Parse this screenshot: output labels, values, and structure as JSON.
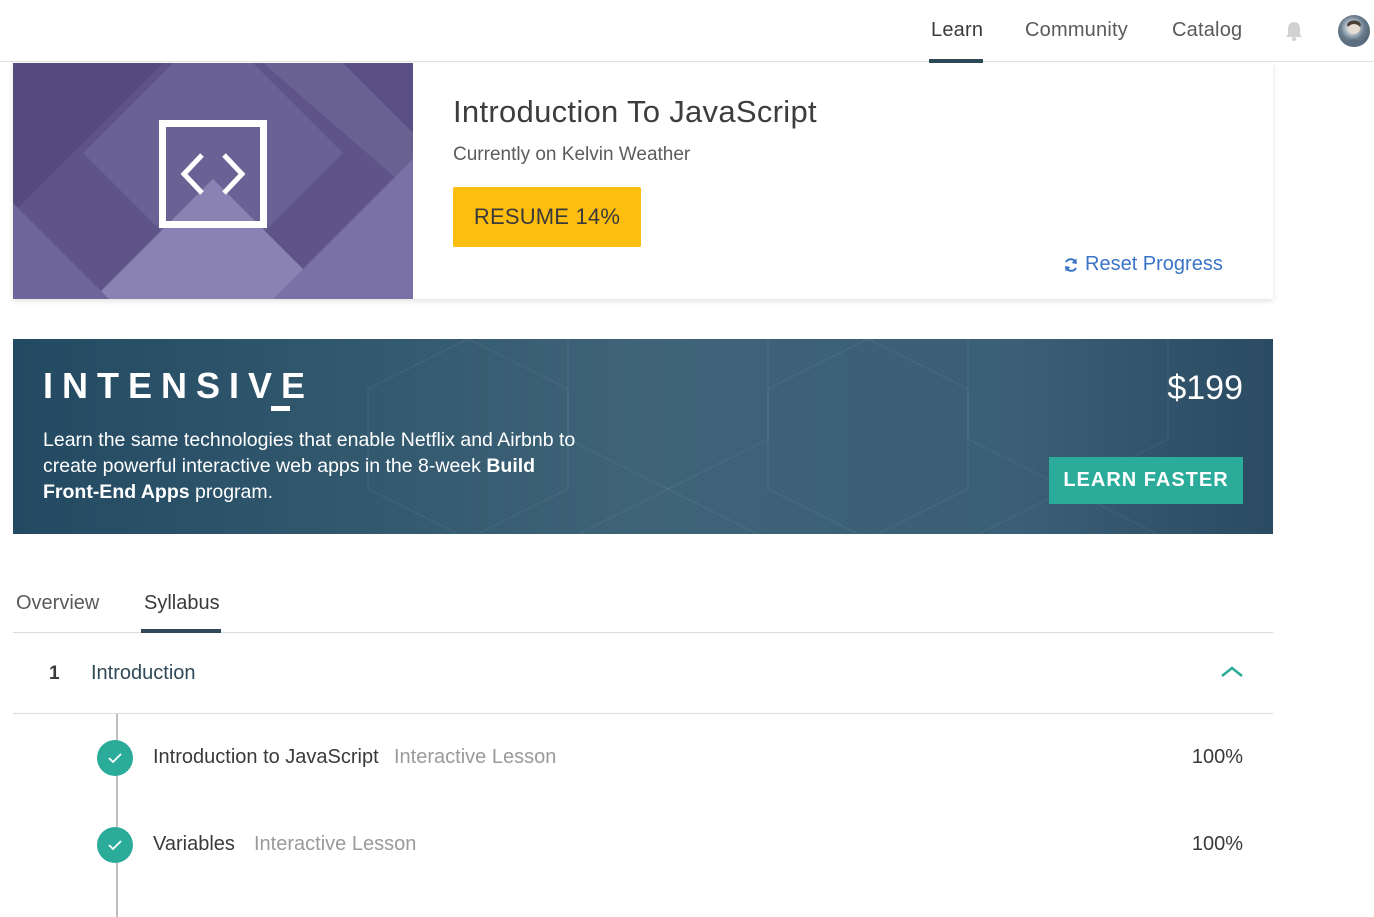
{
  "nav": {
    "items": [
      {
        "label": "Learn",
        "active": true
      },
      {
        "label": "Community",
        "active": false
      },
      {
        "label": "Catalog",
        "active": false
      }
    ],
    "bell_icon": "bell-icon",
    "avatar_icon": "user-avatar"
  },
  "course": {
    "title": "Introduction To JavaScript",
    "subtitle": "Currently on Kelvin Weather",
    "resume_label": "RESUME 14%",
    "progress_percent": 14,
    "reset_label": "Reset Progress",
    "art_icon": "code-brackets-icon",
    "art_color": "#5e5488"
  },
  "banner": {
    "title": "INTENSIVE",
    "text_1": "Learn the same technologies that enable Netflix and Airbnb to create powerful interactive web apps in the 8-week ",
    "text_bold": "Build Front-End Apps",
    "text_2": " program.",
    "price": "$199",
    "cta_label": "LEARN FASTER",
    "cta_color": "#2bab9a"
  },
  "tabs": [
    {
      "label": "Overview",
      "active": false
    },
    {
      "label": "Syllabus",
      "active": true
    }
  ],
  "syllabus": {
    "section": {
      "number": "1",
      "title": "Introduction",
      "expanded": true
    },
    "lessons": [
      {
        "title": "Introduction to JavaScript",
        "type": "Interactive Lesson",
        "percent": "100%",
        "completed": true
      },
      {
        "title": "Variables",
        "type": "Interactive Lesson",
        "percent": "100%",
        "completed": true
      }
    ]
  },
  "colors": {
    "accent_yellow": "#fdbe10",
    "link_blue": "#3a74c7",
    "teal": "#2bab9a",
    "navy": "#2f4959"
  }
}
